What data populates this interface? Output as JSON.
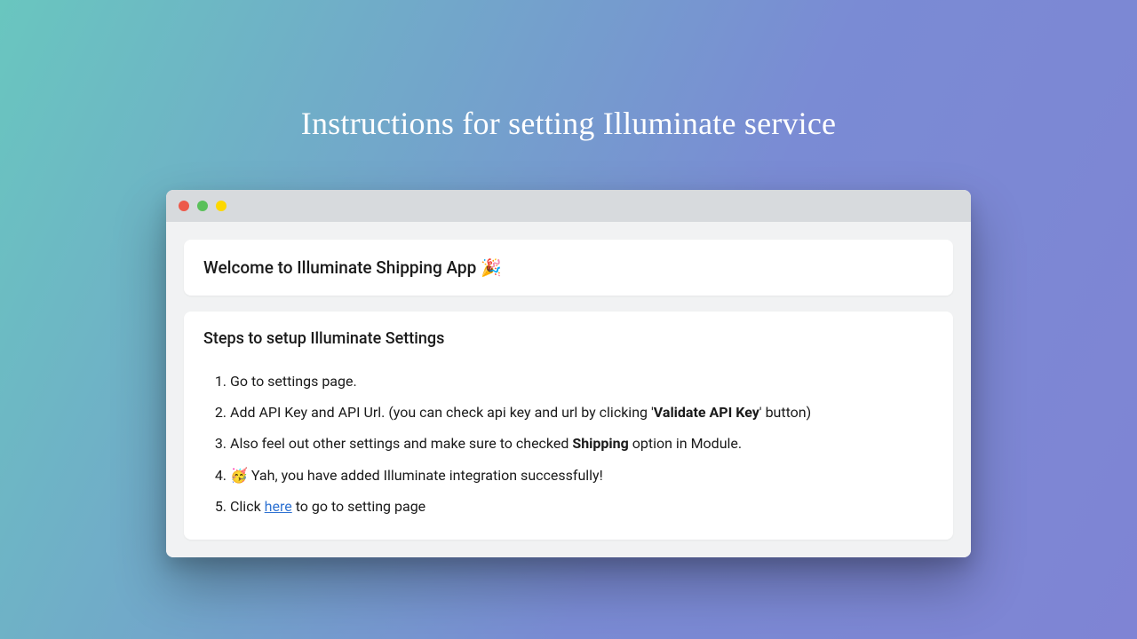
{
  "page": {
    "title": "Instructions for setting Illuminate service"
  },
  "window": {
    "traffic": {
      "close": "close",
      "min": "minimize",
      "max": "maximize"
    }
  },
  "welcome": {
    "text": "Welcome to Illuminate Shipping App 🎉"
  },
  "steps": {
    "heading": "Steps to setup Illuminate Settings",
    "s1": "Go to settings page.",
    "s2_a": "Add API Key and API Url. (you can check api key and url by clicking '",
    "s2_bold": "Validate API Key",
    "s2_b": "' button)",
    "s3_a": "Also feel out other settings and make sure to checked ",
    "s3_bold": "Shipping",
    "s3_b": " option in Module.",
    "s4": "🥳 Yah, you have added Illuminate integration successfully!",
    "s5_a": "Click ",
    "s5_link": "here",
    "s5_b": " to go to setting page"
  }
}
